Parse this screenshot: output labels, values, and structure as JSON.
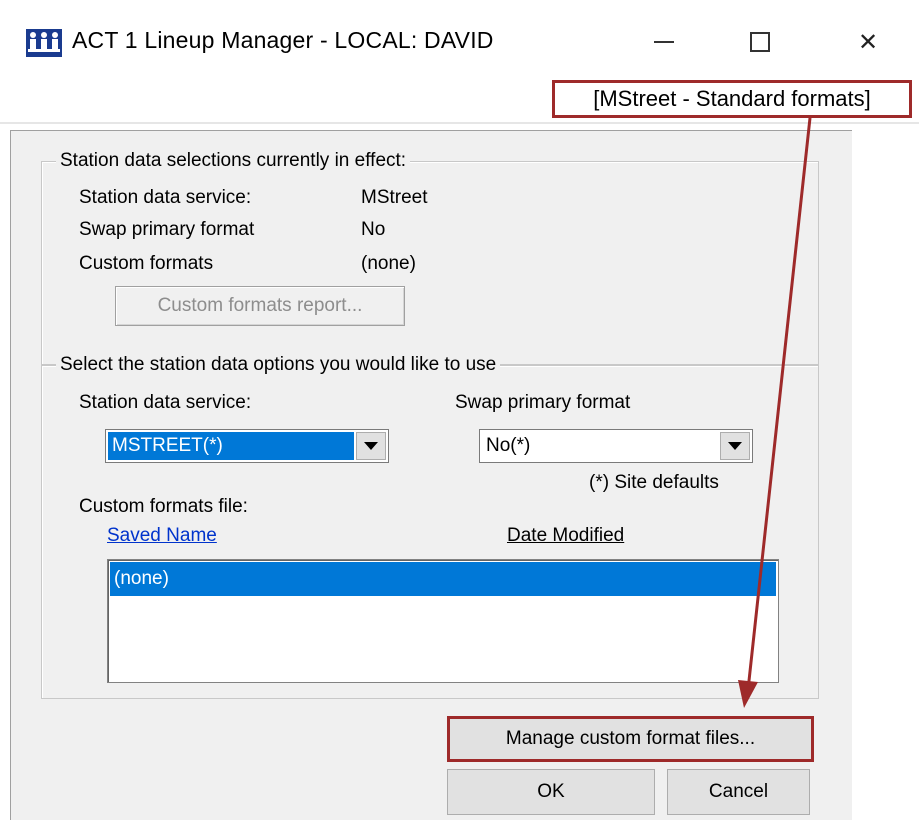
{
  "window": {
    "title": "ACT 1 Lineup Manager - LOCAL: DAVID",
    "icon": "people-group-icon",
    "controls": {
      "minimize": "minimize-icon",
      "maximize": "maximize-icon",
      "close": "close-icon"
    }
  },
  "callout": {
    "text": "[MStreet - Standard formats]",
    "color": "#9e2a2a"
  },
  "current": {
    "title": "Station data selections currently in effect:",
    "rows": [
      {
        "label": "Station data service:",
        "value": "MStreet"
      },
      {
        "label": "Swap primary format",
        "value": "No"
      },
      {
        "label": "Custom formats",
        "value": "(none)"
      }
    ],
    "report_button": "Custom formats report..."
  },
  "options": {
    "title": "Select the station data options you would like to use",
    "service_label": "Station data service:",
    "service_value": "MSTREET(*)",
    "swap_label": "Swap primary format",
    "swap_value": "No(*)",
    "defaults_note": "(*) Site defaults",
    "custom_file_label": "Custom formats file:",
    "columns": {
      "name": "Saved Name",
      "date": "Date Modified"
    },
    "list_items": [
      "(none)"
    ]
  },
  "buttons": {
    "manage": "Manage custom format files...",
    "ok": "OK",
    "cancel": "Cancel"
  },
  "colors": {
    "selection": "#0078d7",
    "link": "#0033cc",
    "annotation": "#9e2a2a"
  }
}
